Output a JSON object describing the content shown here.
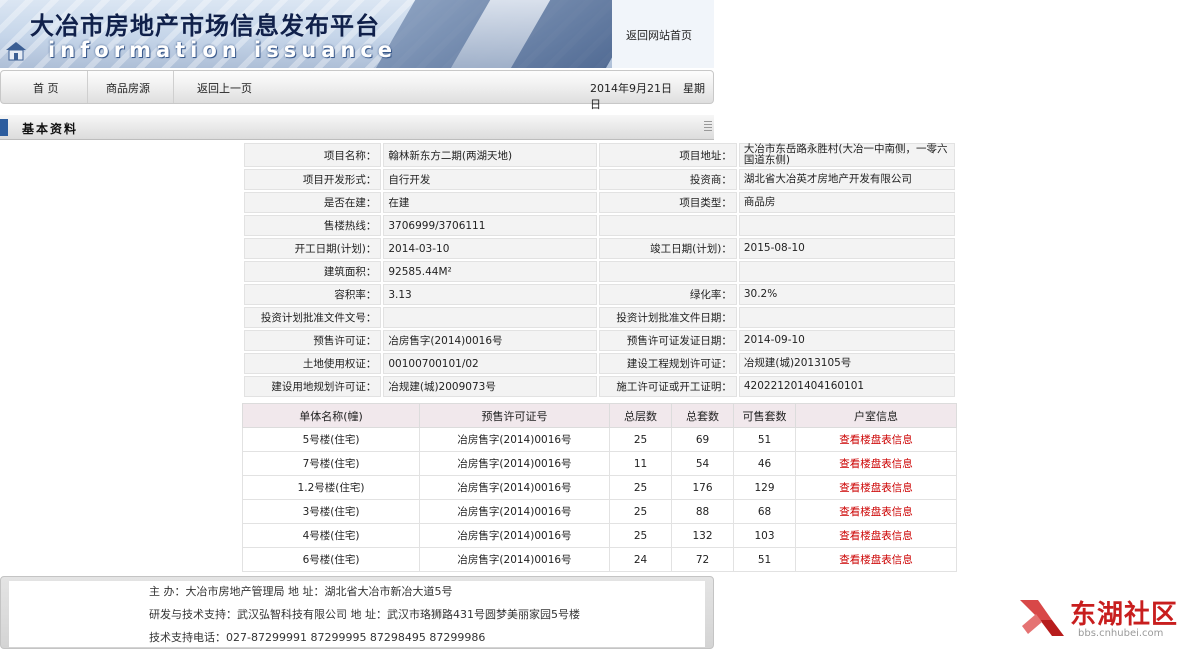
{
  "banner": {
    "title": "大冶市房地产市场信息发布平台",
    "subtitle": "information issuance",
    "back_home": "返回网站首页"
  },
  "nav": {
    "items": [
      "首 页",
      "商品房源",
      "返回上一页"
    ],
    "date": "2014年9月21日",
    "weekday": "星期日"
  },
  "section": {
    "label": "基本资料"
  },
  "info": {
    "rows": [
      {
        "k1": "项目名称：",
        "v1": "翰林新东方二期(两湖天地)",
        "k2": "项目地址：",
        "v2": "大冶市东岳路永胜村(大冶一中南侧，一零六国道东侧)"
      },
      {
        "k1": "项目开发形式：",
        "v1": "自行开发",
        "k2": "投资商：",
        "v2": "湖北省大冶英才房地产开发有限公司"
      },
      {
        "k1": "是否在建：",
        "v1": "在建",
        "k2": "项目类型：",
        "v2": "商品房"
      },
      {
        "k1": "售楼热线：",
        "v1": "3706999/3706111",
        "k2": "",
        "v2": ""
      },
      {
        "k1": "开工日期(计划)：",
        "v1": "2014-03-10",
        "k2": "竣工日期(计划)：",
        "v2": "2015-08-10"
      },
      {
        "k1": "建筑面积：",
        "v1": "92585.44M²",
        "k2": "",
        "v2": ""
      },
      {
        "k1": "容积率：",
        "v1": "3.13",
        "k2": "绿化率：",
        "v2": "30.2%"
      },
      {
        "k1": "投资计划批准文件文号：",
        "v1": "",
        "k2": "投资计划批准文件日期：",
        "v2": ""
      },
      {
        "k1": "预售许可证：",
        "v1": "冶房售字(2014)0016号",
        "k2": "预售许可证发证日期：",
        "v2": "2014-09-10"
      },
      {
        "k1": "土地使用权证：",
        "v1": "00100700101/02",
        "k2": "建设工程规划许可证：",
        "v2": "冶规建(城)2013105号"
      },
      {
        "k1": "建设用地规划许可证：",
        "v1": "冶规建(城)2009073号",
        "k2": "施工许可证或开工证明：",
        "v2": "420221201404160101"
      }
    ]
  },
  "units": {
    "headers": [
      "单体名称(幢)",
      "预售许可证号",
      "总层数",
      "总套数",
      "可售套数",
      "户室信息"
    ],
    "rows": [
      {
        "name": "5号楼(住宅)",
        "permit": "冶房售字(2014)0016号",
        "floors": "25",
        "total": "69",
        "available": "51",
        "link": "查看楼盘表信息"
      },
      {
        "name": "7号楼(住宅)",
        "permit": "冶房售字(2014)0016号",
        "floors": "11",
        "total": "54",
        "available": "46",
        "link": "查看楼盘表信息"
      },
      {
        "name": "1.2号楼(住宅)",
        "permit": "冶房售字(2014)0016号",
        "floors": "25",
        "total": "176",
        "available": "129",
        "link": "查看楼盘表信息"
      },
      {
        "name": "3号楼(住宅)",
        "permit": "冶房售字(2014)0016号",
        "floors": "25",
        "total": "88",
        "available": "68",
        "link": "查看楼盘表信息"
      },
      {
        "name": "4号楼(住宅)",
        "permit": "冶房售字(2014)0016号",
        "floors": "25",
        "total": "132",
        "available": "103",
        "link": "查看楼盘表信息"
      },
      {
        "name": "6号楼(住宅)",
        "permit": "冶房售字(2014)0016号",
        "floors": "24",
        "total": "72",
        "available": "51",
        "link": "查看楼盘表信息"
      }
    ]
  },
  "footer": {
    "line1": "主 办：大冶市房地产管理局    地 址：湖北省大冶市新冶大道5号",
    "line2": "研发与技术支持：武汉弘智科技有限公司 地 址：武汉市珞狮路431号圆梦美丽家园5号楼",
    "line3": "技术支持电话：027-87299991 87299995 87298495 87299986"
  },
  "watermark": {
    "brand": "东湖社区",
    "url": "bbs.cnhubei.com",
    "color": "#c81e1e"
  }
}
